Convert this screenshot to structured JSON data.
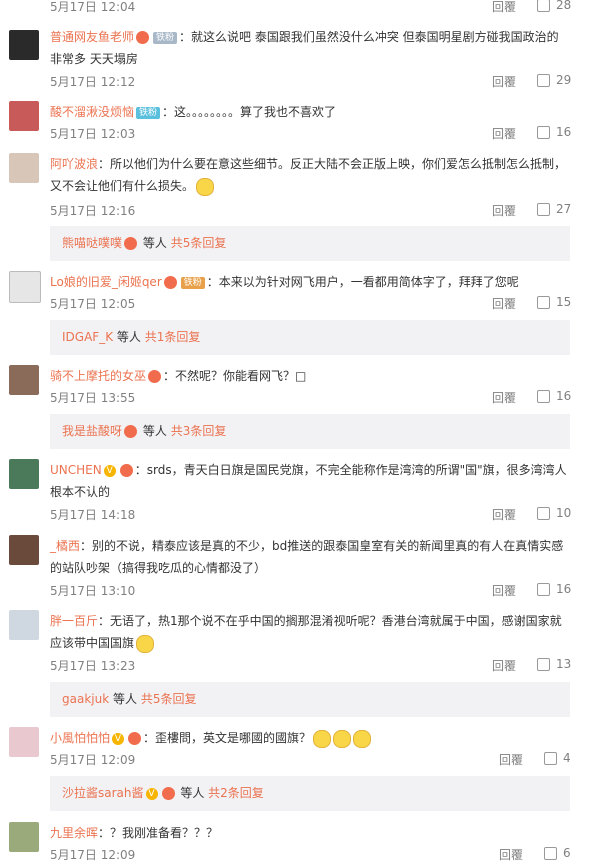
{
  "comments": [
    {
      "user": "",
      "text": "",
      "time": "5月17日 12:04",
      "reply": "回覆",
      "likes": "28"
    },
    {
      "user": "普通网友鱼老师",
      "badge": "铁粉",
      "text": "：就这么说吧 泰国跟我们虽然没什么冲突 但泰国明星剧方碰我国政治的非常多 天天塌房",
      "time": "5月17日 12:12",
      "reply": "回覆",
      "likes": "29"
    },
    {
      "user": "酸不溜湫没烦恼",
      "badge": "铁粉",
      "text": "：这。。。。。。。。算了我也不喜欢了",
      "time": "5月17日 12:03",
      "reply": "回覆",
      "likes": "16"
    },
    {
      "user": "阿吖波浪",
      "text": "：所以他们为什么要在意这些细节。反正大陆不会正版上映，你们爱怎么抵制怎么抵制，又不会让他们有什么损失。",
      "time": "5月17日 12:16",
      "reply": "回覆",
      "likes": "27",
      "sub": {
        "who": "熊喵哒噗噗",
        "etc": "等人",
        "more": "共5条回复"
      }
    },
    {
      "user": "Lo娘的旧爱_闲姬qer",
      "badge": "铁粉",
      "text": "：本来以为针对网飞用户，一看都用简体字了，拜拜了您呢",
      "time": "5月17日 12:05",
      "reply": "回覆",
      "likes": "15",
      "sub": {
        "who": "IDGAF_K",
        "etc": "等人",
        "more": "共1条回复"
      }
    },
    {
      "user": "骑不上摩托的女巫",
      "text": "：不然呢？你能看网飞？□",
      "time": "5月17日 13:55",
      "reply": "回覆",
      "likes": "16",
      "sub": {
        "who": "我是盐酸呀",
        "etc": "等人",
        "more": "共3条回复"
      }
    },
    {
      "user": "UNCHEN",
      "text": "：srds，青天白日旗是国民党旗，不完全能称作是湾湾的所谓\"国\"旗，很多湾湾人根本不认的",
      "time": "5月17日 14:18",
      "reply": "回覆",
      "likes": "10"
    },
    {
      "user": "_橘西",
      "text": "：别的不说，精泰应该是真的不少，bd推送的跟泰国皇室有关的新闻里真的有人在真情实感的站队吵架（搞得我吃瓜的心情都没了）",
      "time": "5月17日 13:10",
      "reply": "回覆",
      "likes": "16"
    },
    {
      "user": "胖一百斤",
      "text": "：无语了，热1那个说不在乎中国的搁那混淆视听呢？香港台湾就属于中国，感谢国家就应该带中国国旗",
      "time": "5月17日 13:23",
      "reply": "回覆",
      "likes": "13",
      "sub": {
        "who": "gaakjuk",
        "etc": "等人",
        "more": "共5条回复"
      }
    },
    {
      "user": "小風怕怕怕",
      "text": "：歪樓問，英文是哪國的國旗？",
      "time": "5月17日 12:09",
      "reply": "回覆",
      "likes": "4",
      "sub": {
        "who": "沙拉酱sarah酱",
        "etc": "等人",
        "more": "共2条回复"
      }
    },
    {
      "user": "九里余晖",
      "text": "：？我刚准备看？？？",
      "time": "5月17日 12:09",
      "reply": "回覆",
      "likes": "6"
    }
  ]
}
